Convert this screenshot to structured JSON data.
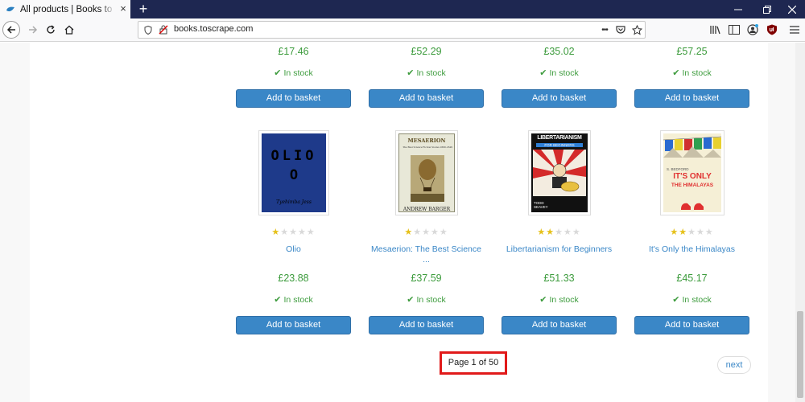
{
  "browser": {
    "tab_title": "All products | Books to Scrape",
    "tab_close": "×",
    "new_tab": "+",
    "url": "books.toscrape.com",
    "page_actions": "•••"
  },
  "top_row": [
    {
      "price": "£17.46",
      "stock": "In stock",
      "button": "Add to basket"
    },
    {
      "price": "£52.29",
      "stock": "In stock",
      "button": "Add to basket"
    },
    {
      "price": "£35.02",
      "stock": "In stock",
      "button": "Add to basket"
    },
    {
      "price": "£57.25",
      "stock": "In stock",
      "button": "Add to basket"
    }
  ],
  "books": [
    {
      "title": "Olio",
      "rating": 1,
      "price": "£23.88",
      "stock": "In stock",
      "button": "Add to basket",
      "cover": {
        "text1": "OLIO",
        "text2": "O",
        "author": "Tyehimba Jess",
        "bg": "#1e3a8a"
      }
    },
    {
      "title": "Mesaerion: The Best Science ...",
      "rating": 1,
      "price": "£37.59",
      "stock": "In stock",
      "button": "Add to basket",
      "cover": {
        "text1": "MESAERION",
        "text2": "The Best Science Fiction Stories 1800-1849",
        "author": "ANDREW BARGER",
        "bg": "#e8e8d8"
      }
    },
    {
      "title": "Libertarianism for Beginners",
      "rating": 2,
      "price": "£51.33",
      "stock": "In stock",
      "button": "Add to basket",
      "cover": {
        "text1": "LIBERTARIANISM",
        "text2": "FOR BEGINNERS",
        "author": "TODD SEAVEY",
        "bg": "#111111"
      }
    },
    {
      "title": "It's Only the Himalayas",
      "rating": 2,
      "price": "£45.17",
      "stock": "In stock",
      "button": "Add to basket",
      "cover": {
        "text1": "IT'S ONLY",
        "text2": "THE HIMALAYAS",
        "author": "S. BEDFORD",
        "bg": "#f5efd6"
      }
    }
  ],
  "pager": {
    "current": "Page 1 of 50",
    "next": "next"
  },
  "colors": {
    "accent": "#3a87c7",
    "price_green": "#3c9b3c",
    "highlight": "#e11a1a",
    "star": "#e6c11a"
  }
}
